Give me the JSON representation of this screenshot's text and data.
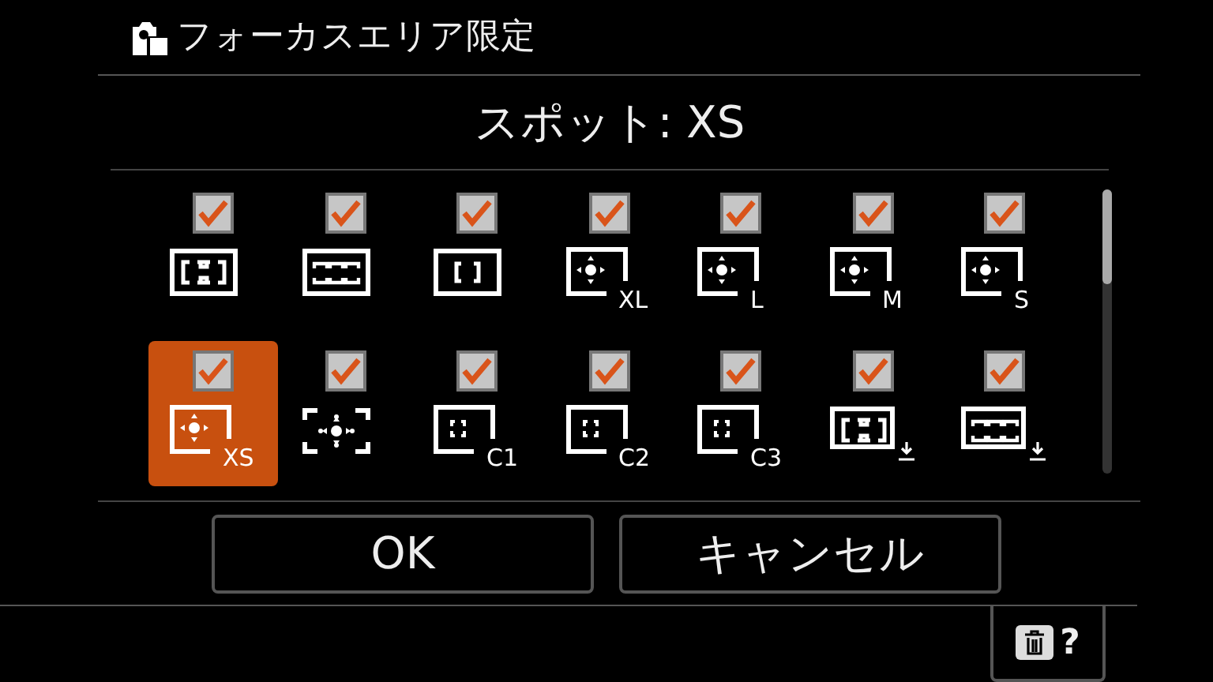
{
  "header": {
    "title": "フォーカスエリア限定"
  },
  "current": {
    "label": "スポット: XS"
  },
  "items": [
    {
      "kind": "wide",
      "checked": true,
      "selected": false
    },
    {
      "kind": "zone",
      "checked": true,
      "selected": false
    },
    {
      "kind": "center",
      "checked": true,
      "selected": false
    },
    {
      "kind": "spot",
      "suffix": "XL",
      "checked": true,
      "selected": false
    },
    {
      "kind": "spot",
      "suffix": "L",
      "checked": true,
      "selected": false
    },
    {
      "kind": "spot",
      "suffix": "M",
      "checked": true,
      "selected": false
    },
    {
      "kind": "spot",
      "suffix": "S",
      "checked": true,
      "selected": false
    },
    {
      "kind": "spot",
      "suffix": "XS",
      "checked": true,
      "selected": true
    },
    {
      "kind": "expanded",
      "checked": true,
      "selected": false
    },
    {
      "kind": "custom",
      "suffix": "C1",
      "checked": true,
      "selected": false
    },
    {
      "kind": "custom",
      "suffix": "C2",
      "checked": true,
      "selected": false
    },
    {
      "kind": "custom",
      "suffix": "C3",
      "checked": true,
      "selected": false
    },
    {
      "kind": "wide-tracking",
      "checked": true,
      "selected": false
    },
    {
      "kind": "zone-tracking",
      "checked": true,
      "selected": false
    }
  ],
  "buttons": [
    {
      "label": "OK"
    },
    {
      "label": "キャンセル"
    }
  ],
  "help": {
    "label": "?"
  }
}
